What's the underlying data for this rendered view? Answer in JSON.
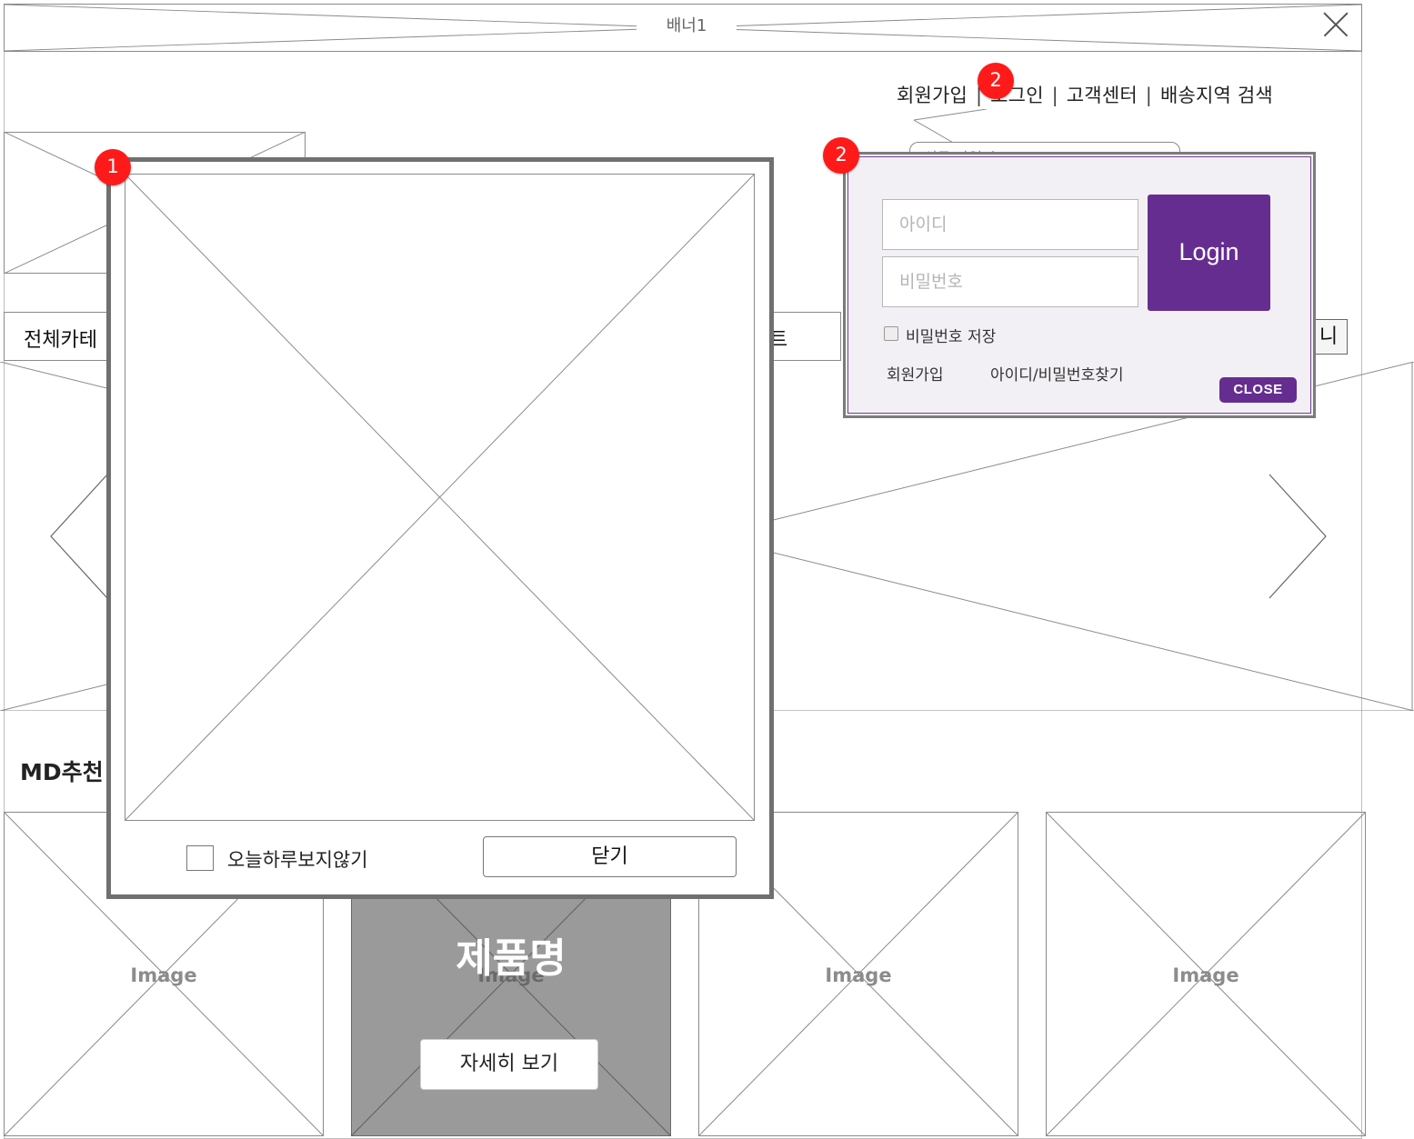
{
  "banner": {
    "label": "배너1"
  },
  "util_nav": {
    "signup": "회원가입",
    "login": "로그인",
    "customer_center": "고객센터",
    "delivery_search": "배송지역 검색",
    "separator": "|"
  },
  "category_bar": {
    "label": "전체카테",
    "label_partial": "트",
    "right_label": "니"
  },
  "md_section": {
    "title": "MD추천"
  },
  "products": [
    {
      "image_label": "Image"
    },
    {
      "image_label": "Image",
      "name": "제품명",
      "detail_button": "자세히 보기"
    },
    {
      "image_label": "Image"
    },
    {
      "image_label": "Image"
    }
  ],
  "popup": {
    "dont_show_today": "오늘하루보지않기",
    "close_button": "닫기"
  },
  "login_popup": {
    "id_placeholder": "아이디",
    "pw_placeholder": "비밀번호",
    "login_button": "Login",
    "save_password": "비밀번호 저장",
    "signup_link": "회원가입",
    "find_link": "아이디/비밀번호찾기",
    "close_button": "CLOSE",
    "accent_color": "#662d91"
  },
  "badges": {
    "one": "1",
    "two": "2"
  },
  "bubble": {
    "text": "신규 가입시"
  }
}
